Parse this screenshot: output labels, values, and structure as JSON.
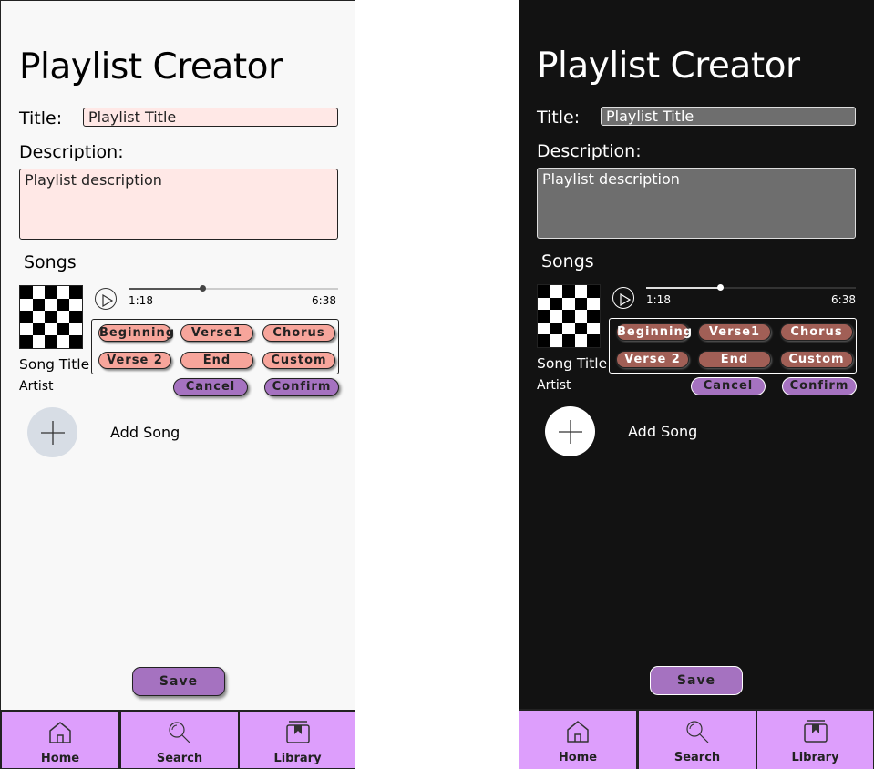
{
  "screens": [
    {
      "theme": "light",
      "app_title": "Playlist Creator",
      "title_label": "Title:",
      "title_value": "Playlist Title",
      "description_label": "Description:",
      "description_value": "Playlist description",
      "songs_heading": "Songs",
      "song": {
        "title": "Song Title",
        "artist": "Artist",
        "current_time": "1:18",
        "total_time": "6:38",
        "progress_fraction": 0.35
      },
      "sections": [
        "Beginning",
        "Verse1",
        "Chorus",
        "Verse 2",
        "End",
        "Custom"
      ],
      "cancel_label": "Cancel",
      "confirm_label": "Confirm",
      "add_song_label": "Add Song",
      "save_label": "Save",
      "nav": [
        "Home",
        "Search",
        "Library"
      ]
    },
    {
      "theme": "dark",
      "app_title": "Playlist Creator",
      "title_label": "Title:",
      "title_value": "Playlist Title",
      "description_label": "Description:",
      "description_value": "Playlist description",
      "songs_heading": "Songs",
      "song": {
        "title": "Song Title",
        "artist": "Artist",
        "current_time": "1:18",
        "total_time": "6:38",
        "progress_fraction": 0.35
      },
      "sections": [
        "Beginning",
        "Verse1",
        "Chorus",
        "Verse 2",
        "End",
        "Custom"
      ],
      "cancel_label": "Cancel",
      "confirm_label": "Confirm",
      "add_song_label": "Add Song",
      "save_label": "Save",
      "nav": [
        "Home",
        "Search",
        "Library"
      ]
    }
  ],
  "colors": {
    "light_background": "#f8f8f8",
    "dark_background": "#121212",
    "input_light": "#ffe8e6",
    "input_dark": "#6e6e6e",
    "chip_light": "#f7a59b",
    "chip_dark": "#a15f56",
    "action_purple": "#a572c0",
    "nav_purple": "#dd9efc"
  },
  "icons": {
    "play": "play-icon",
    "add": "plus-icon",
    "home": "home-icon",
    "search": "search-icon",
    "library": "library-icon"
  }
}
